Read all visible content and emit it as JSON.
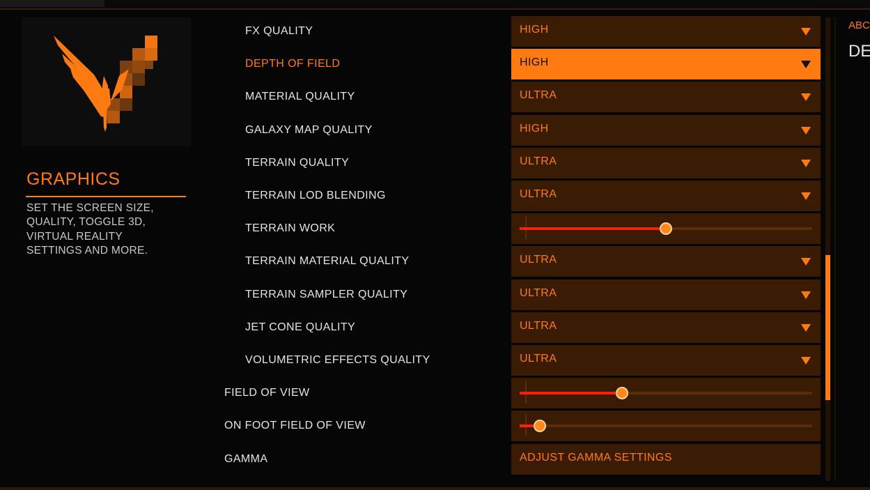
{
  "section": {
    "title": "GRAPHICS",
    "description": "SET THE SCREEN SIZE,\nQUALITY, TOGGLE 3D,\nVIRTUAL REALITY\nSETTINGS AND MORE."
  },
  "settings": [
    {
      "label": "FX QUALITY",
      "type": "dropdown",
      "value": "HIGH"
    },
    {
      "label": "DEPTH OF FIELD",
      "type": "dropdown",
      "value": "HIGH",
      "active": true
    },
    {
      "label": "MATERIAL QUALITY",
      "type": "dropdown",
      "value": "ULTRA"
    },
    {
      "label": "GALAXY MAP QUALITY",
      "type": "dropdown",
      "value": "HIGH"
    },
    {
      "label": "TERRAIN QUALITY",
      "type": "dropdown",
      "value": "ULTRA"
    },
    {
      "label": "TERRAIN LOD BLENDING",
      "type": "dropdown",
      "value": "ULTRA"
    },
    {
      "label": "TERRAIN WORK",
      "type": "slider",
      "value_fraction": 0.5
    },
    {
      "label": "TERRAIN MATERIAL QUALITY",
      "type": "dropdown",
      "value": "ULTRA"
    },
    {
      "label": "TERRAIN SAMPLER QUALITY",
      "type": "dropdown",
      "value": "ULTRA"
    },
    {
      "label": "JET CONE QUALITY",
      "type": "dropdown",
      "value": "ULTRA"
    },
    {
      "label": "VOLUMETRIC EFFECTS QUALITY",
      "type": "dropdown",
      "value": "ULTRA"
    },
    {
      "label": "FIELD OF VIEW",
      "type": "slider",
      "value_fraction": 0.35
    },
    {
      "label": "ON FOOT FIELD OF VIEW",
      "type": "slider",
      "value_fraction": 0.07
    },
    {
      "label": "GAMMA",
      "type": "button",
      "value": "ADJUST GAMMA SETTINGS"
    }
  ],
  "right_panel": {
    "heading": "ABC",
    "subheading": "DE"
  },
  "colors": {
    "accent": "#ff7b12",
    "control_bg": "#3a1b03",
    "slider_fill": "#ff1e0c",
    "background": "#060606"
  }
}
